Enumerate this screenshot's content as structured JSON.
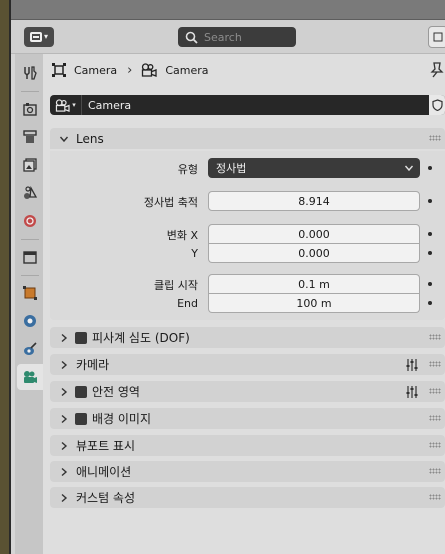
{
  "header": {
    "search_placeholder": "Search"
  },
  "breadcrumb": {
    "object_label": "Camera",
    "data_label": "Camera"
  },
  "datablock": {
    "name": "Camera"
  },
  "lens": {
    "title": "Lens",
    "type_label": "유형",
    "type_value": "정사법",
    "ortho_scale_label": "정사법 축적",
    "ortho_scale_value": "8.914",
    "shift_x_label": "변화 X",
    "shift_x_value": "0.000",
    "shift_y_label": "Y",
    "shift_y_value": "0.000",
    "clip_start_label": "클립 시작",
    "clip_start_value": "0.1 m",
    "clip_end_label": "End",
    "clip_end_value": "100 m"
  },
  "panels": {
    "dof": "피사계 심도 (DOF)",
    "camera": "카메라",
    "safe_areas": "안전 영역",
    "background_images": "배경 이미지",
    "viewport_display": "뷰포트 표시",
    "animation": "애니메이션",
    "custom_properties": "커스텀 속성"
  },
  "colors": {
    "accent_tool": "#c87a2c",
    "accent_physics": "#c24a4a",
    "accent_constraint": "#3a6ea0",
    "accent_camera_data": "#2f8a6e"
  }
}
